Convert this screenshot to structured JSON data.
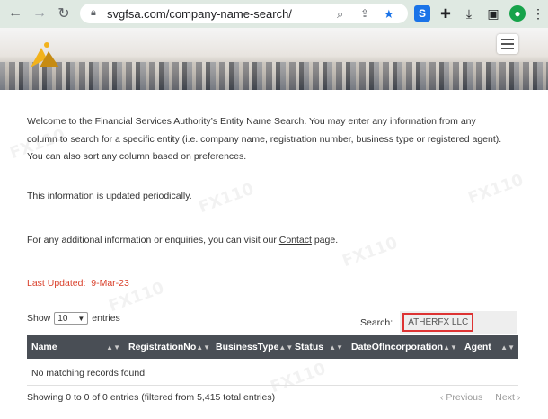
{
  "browser": {
    "url": "svgfsa.com/company-name-search/",
    "icons": [
      "back-icon",
      "forward-icon",
      "reload-icon",
      "lock-icon",
      "zoom-icon",
      "share-icon",
      "star-icon",
      "s-extension-icon",
      "puzzle-icon",
      "download-icon",
      "sidebar-icon",
      "avatar-icon"
    ]
  },
  "site": {
    "menu_icon": "hamburger-icon"
  },
  "intro": {
    "line1": "Welcome to the Financial Services Authority’s Entity Name Search. You may enter any information from any",
    "line2": "column to search for a specific entity (i.e. company name, registration number, business type or registered agent).",
    "line3": "You can also sort any column based on preferences.",
    "periodic": "This information is updated periodically.",
    "contact_before": "For any additional information or enquiries, you can visit our ",
    "contact_link": "Contact",
    "contact_after": " page."
  },
  "last_updated": {
    "label": "Last Updated:",
    "value": "9-Mar-23"
  },
  "table_controls": {
    "show_label": "Show",
    "entries_value": "10",
    "entries_label": "entries",
    "search_label": "Search:",
    "search_value": "ATHERFX LLC"
  },
  "table": {
    "columns": [
      "Name",
      "RegistrationNo",
      "BusinessType",
      "Status",
      "DateOfIncorporation",
      "Agent"
    ],
    "empty_message": "No matching records found",
    "info": "Showing 0 to 0 of 0 entries (filtered from 5,415 total entries)",
    "prev": "Previous",
    "next": "Next"
  },
  "colors": {
    "chrome_bg": "#dfe9e2",
    "header_bg": "#494e55",
    "last_updated": "#d9402b",
    "search_highlight": "#dd3333"
  }
}
